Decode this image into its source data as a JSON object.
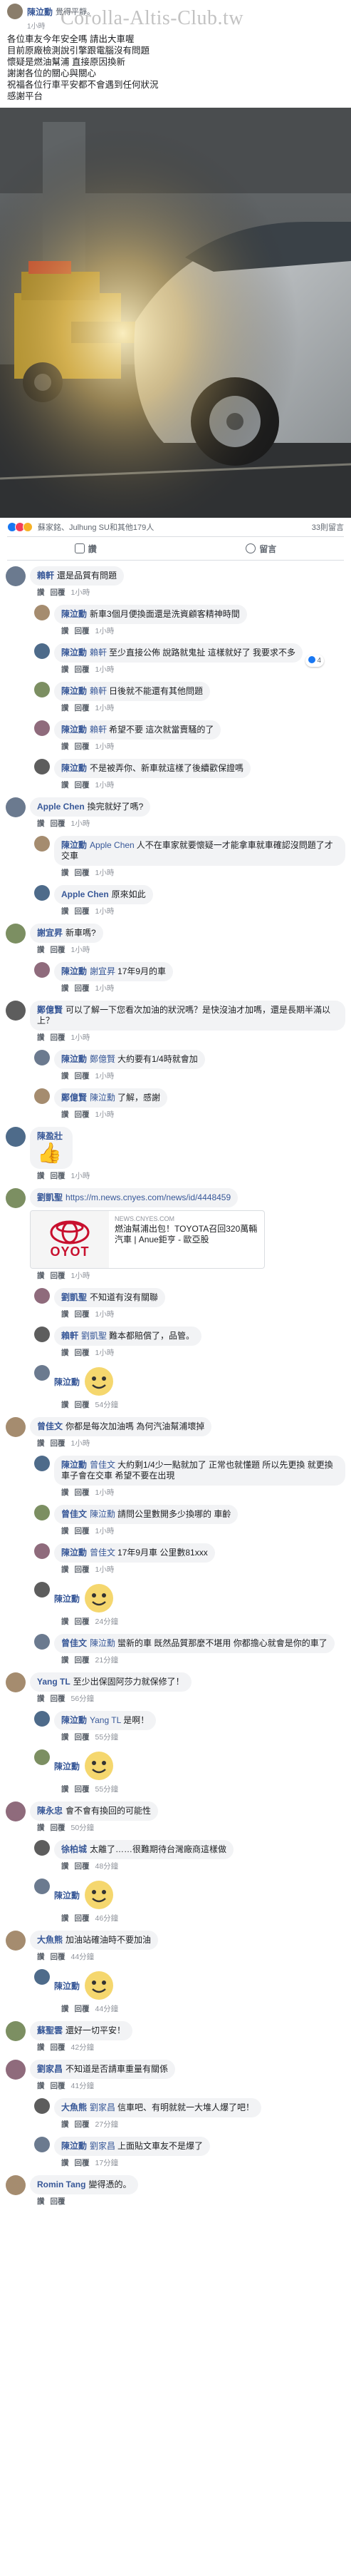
{
  "post": {
    "author": "陳泣勳",
    "feeling": "覺得平靜。",
    "time": "1小時",
    "watermark": "Corolla-Altis-Club.tw",
    "body_lines": [
      "各位車友今年安全嗎  請出大車喔",
      "目前原廠檢測說引擎跟電腦沒有問題",
      "懷疑是燃油幫浦 直接原因換新",
      "謝謝各位的關心與關心",
      "祝福各位行車平安都不會遇到任何狀況",
      "感謝平台"
    ]
  },
  "reactions": {
    "summary": "蘇家銘、Julhung SU和其他179人",
    "comments_count": "33則留言"
  },
  "actions": {
    "like": "讚",
    "comment": "留言"
  },
  "link_card": {
    "source": "NEWS.CNYES.COM",
    "title": "燃油幫浦出包！TOYOTA召回320萬輛汽車 | Anue鉅亨 - 歐亞股",
    "thumb_text": "OYOT"
  },
  "comments": [
    {
      "name": "賴軒",
      "text": "還是品質有問題",
      "meta_like": "讚",
      "meta_reply": "回覆",
      "time": "1小時",
      "reply": false
    },
    {
      "name": "陳泣勳",
      "text": "新車3個月便換面還是洗資顧客精神時間",
      "meta_like": "讚",
      "meta_reply": "回覆",
      "time": "1小時",
      "reply": true
    },
    {
      "name": "陳泣勳",
      "tag": "賴軒",
      "text": "至少直接公佈 說路就鬼扯 這樣就好了 我要求不多",
      "meta_like": "讚",
      "meta_reply": "回覆",
      "time": "1小時",
      "reply": true,
      "badge": "4"
    },
    {
      "name": "陳泣勳",
      "tag": "賴軒",
      "text": "日後就不能還有其他問題",
      "meta_like": "讚",
      "meta_reply": "回覆",
      "time": "1小時",
      "reply": true
    },
    {
      "name": "陳泣勳",
      "tag": "賴軒",
      "text": "希望不要 這次就當賣騷的了",
      "meta_like": "讚",
      "meta_reply": "回覆",
      "time": "1小時",
      "reply": true
    },
    {
      "name": "陳泣勳",
      "text": "不是被弄你、新車就這樣了後續歡保證嗎",
      "meta_like": "讚",
      "meta_reply": "回覆",
      "time": "1小時",
      "reply": true
    },
    {
      "name": "Apple Chen",
      "text": "換完就好了嗎?",
      "meta_like": "讚",
      "meta_reply": "回覆",
      "time": "1小時",
      "reply": false
    },
    {
      "name": "陳泣勳",
      "tag": "Apple Chen",
      "text": "人不在車家就要懷疑一才能拿車就車確認沒問題了才交車",
      "meta_like": "讚",
      "meta_reply": "回覆",
      "time": "1小時",
      "reply": true
    },
    {
      "name": "Apple Chen",
      "text": "原來如此",
      "meta_like": "讚",
      "meta_reply": "回覆",
      "time": "1小時",
      "reply": true
    },
    {
      "name": "謝宜昇",
      "text": "新車嗎?",
      "meta_like": "讚",
      "meta_reply": "回覆",
      "time": "1小時",
      "reply": false
    },
    {
      "name": "陳泣勳",
      "tag": "謝宜昇",
      "text": "17年9月的車",
      "meta_like": "讚",
      "meta_reply": "回覆",
      "time": "1小時",
      "reply": true
    },
    {
      "name": "鄭億賢",
      "text": "可以了解一下您看次加油的狀況嗎？是快沒油才加嗎，還是長期半滿以上？",
      "meta_like": "讚",
      "meta_reply": "回覆",
      "time": "1小時",
      "reply": false
    },
    {
      "name": "陳泣勳",
      "tag": "鄭億賢",
      "text": "大約要有1/4時就會加",
      "meta_like": "讚",
      "meta_reply": "回覆",
      "time": "1小時",
      "reply": true
    },
    {
      "name": "鄭億賢",
      "tag": "陳泣勳",
      "text": "了解，感謝",
      "meta_like": "讚",
      "meta_reply": "回覆",
      "time": "1小時",
      "reply": true
    },
    {
      "name": "陳盈壯",
      "text": "",
      "meta_like": "讚",
      "meta_reply": "回覆",
      "time": "1小時",
      "reply": false,
      "emoji": "👍"
    },
    {
      "name": "劉凱聖",
      "text": "https://m.news.cnyes.com/news/id/4448459",
      "meta_like": "讚",
      "meta_reply": "回覆",
      "time": "1小時",
      "reply": false,
      "card": true
    },
    {
      "name": "劉凱聖",
      "text": "不知道有沒有關聯",
      "meta_like": "讚",
      "meta_reply": "回覆",
      "time": "1小時",
      "reply": true
    },
    {
      "name": "賴軒",
      "tag": "劉凱聖",
      "text": "難本都賠償了，品管。",
      "meta_like": "讚",
      "meta_reply": "回覆",
      "time": "1小時",
      "reply": true
    },
    {
      "name": "陳泣勳",
      "text": "",
      "meta_like": "讚",
      "meta_reply": "回覆",
      "time": "54分鐘",
      "reply": true
    },
    {
      "name": "曾佳文",
      "text": "你都是每次加油嗎 為何汽油幫浦壞掉",
      "meta_like": "讚",
      "meta_reply": "回覆",
      "time": "1小時",
      "reply": false
    },
    {
      "name": "陳泣勳",
      "tag": "曾佳文",
      "text": "大約剩1/4少一點就加了 正常也就懂題 所以先更換 就更換車子會在交車 希望不要在出現",
      "meta_like": "讚",
      "meta_reply": "回覆",
      "time": "1小時",
      "reply": true
    },
    {
      "name": "曾佳文",
      "tag": "陳泣勳",
      "text": "請問公里數開多少換哪的 車齡",
      "meta_like": "讚",
      "meta_reply": "回覆",
      "time": "1小時",
      "reply": true
    },
    {
      "name": "陳泣勳",
      "tag": "曾佳文",
      "text": "17年9月車 公里數81xxx",
      "meta_like": "讚",
      "meta_reply": "回覆",
      "time": "1小時",
      "reply": true
    },
    {
      "name": "陳泣勳",
      "text": "",
      "meta_like": "讚",
      "meta_reply": "回覆",
      "time": "24分鐘",
      "reply": true
    },
    {
      "name": "曾佳文",
      "tag": "陳泣勳",
      "text": "蠻新的車 既然品質那麼不堪用 你都擔心就會是你的車了",
      "meta_like": "讚",
      "meta_reply": "回覆",
      "time": "21分鐘",
      "reply": true
    },
    {
      "name": "Yang TL",
      "text": "至少出保固阿莎力就保修了！",
      "meta_like": "讚",
      "meta_reply": "回覆",
      "time": "56分鐘",
      "reply": false
    },
    {
      "name": "陳泣勳",
      "tag": "Yang TL",
      "text": "是啊！",
      "meta_like": "讚",
      "meta_reply": "回覆",
      "time": "55分鐘",
      "reply": true
    },
    {
      "name": "陳泣勳",
      "text": "",
      "meta_like": "讚",
      "meta_reply": "回覆",
      "time": "55分鐘",
      "reply": true
    },
    {
      "name": "陳永忠",
      "text": "會不會有換回的可能性",
      "meta_like": "讚",
      "meta_reply": "回覆",
      "time": "50分鐘",
      "reply": false
    },
    {
      "name": "徐柏城",
      "text": "太離了……很難期待台灣廠商這樣做",
      "meta_like": "讚",
      "meta_reply": "回覆",
      "time": "48分鐘",
      "reply": true
    },
    {
      "name": "陳泣勳",
      "text": "",
      "meta_like": "讚",
      "meta_reply": "回覆",
      "time": "46分鐘",
      "reply": true
    },
    {
      "name": "大魚熊",
      "text": "加油站確油時不要加油",
      "meta_like": "讚",
      "meta_reply": "回覆",
      "time": "44分鐘",
      "reply": false
    },
    {
      "name": "陳泣勳",
      "text": "",
      "meta_like": "讚",
      "meta_reply": "回覆",
      "time": "44分鐘",
      "reply": true
    },
    {
      "name": "蘇聖雲",
      "text": "還好一切平安！",
      "meta_like": "讚",
      "meta_reply": "回覆",
      "time": "42分鐘",
      "reply": false
    },
    {
      "name": "劉家昌",
      "text": "不知道是否請車重量有關係",
      "meta_like": "讚",
      "meta_reply": "回覆",
      "time": "41分鐘",
      "reply": false
    },
    {
      "name": "大魚熊",
      "tag": "劉家昌",
      "text": "信車吧、有明就就一大堆人爆了吧！",
      "meta_like": "讚",
      "meta_reply": "回覆",
      "time": "27分鐘",
      "reply": true
    },
    {
      "name": "陳泣勳",
      "tag": "劉家昌",
      "text": "上面貼文車友不是爆了",
      "meta_like": "讚",
      "meta_reply": "回覆",
      "time": "17分鐘",
      "reply": true
    },
    {
      "name": "Romin Tang",
      "text": "變得憑的。",
      "meta_like": "讚",
      "meta_reply": "回覆",
      "time": "",
      "reply": false
    }
  ],
  "colors": {
    "link": "#385898",
    "bubble": "#f2f3f5",
    "meta": "#90949c"
  }
}
